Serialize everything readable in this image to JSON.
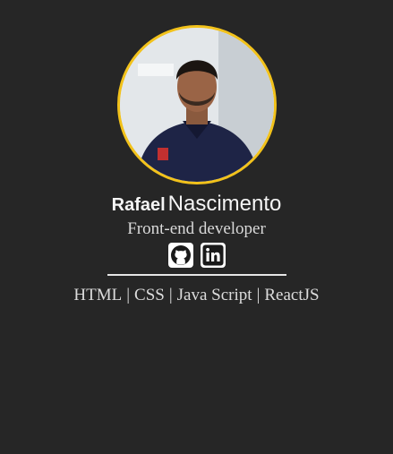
{
  "profile": {
    "first_name": "Rafael",
    "last_name": "Nascimento",
    "role": "Front-end developer"
  },
  "social": [
    {
      "icon": "github-icon"
    },
    {
      "icon": "linkedin-icon"
    }
  ],
  "skills": {
    "items": [
      "HTML",
      "CSS",
      "Java Script",
      "ReactJS"
    ],
    "separator": "|"
  },
  "colors": {
    "background": "#262626",
    "avatar_border": "#f2c21b",
    "text": "#f5f5f5"
  }
}
